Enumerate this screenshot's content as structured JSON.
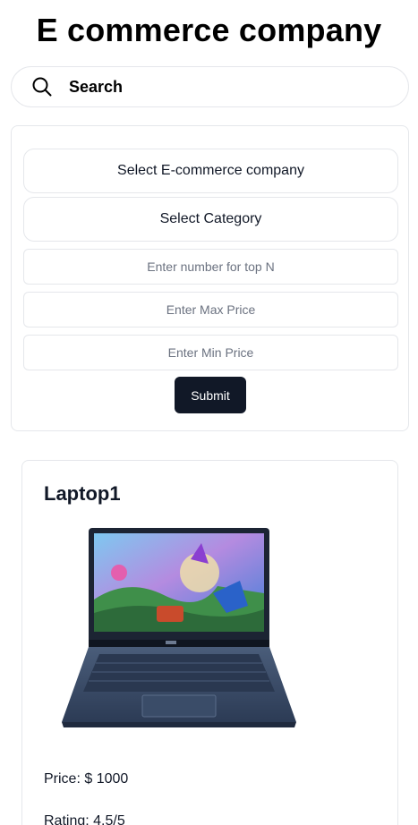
{
  "header": {
    "title": "E commerce company"
  },
  "search": {
    "placeholder": "Search",
    "icon": "search-icon"
  },
  "filters": {
    "company_select_label": "Select E-commerce company",
    "category_select_label": "Select Category",
    "top_n_placeholder": "Enter number for top N",
    "max_price_placeholder": "Enter Max Price",
    "min_price_placeholder": "Enter Min Price",
    "submit_label": "Submit"
  },
  "products": [
    {
      "name": "Laptop1",
      "price": "Price: $ 1000",
      "rating": "Rating: 4.5/5"
    }
  ],
  "colors": {
    "submit_bg": "#111827",
    "border": "#e5e7eb",
    "placeholder": "#6b7280"
  }
}
